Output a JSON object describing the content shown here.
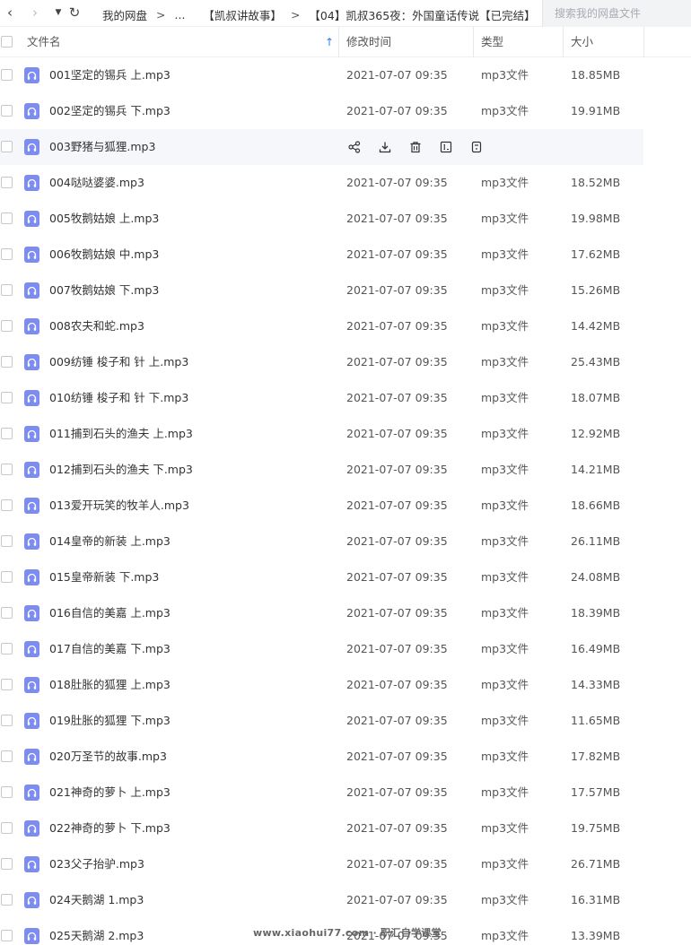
{
  "toolbar": {
    "back_glyph": "‹",
    "forward_glyph": "›",
    "dropdown_glyph": "▼",
    "refresh_glyph": "↻",
    "breadcrumbs": [
      "我的网盘",
      "...",
      "【凯叔讲故事】",
      "【04】凯叔365夜：外国童话传说【已完结】"
    ],
    "separator": ">"
  },
  "search": {
    "placeholder": "搜索我的网盘文件"
  },
  "header": {
    "name": "文件名",
    "time": "修改时间",
    "type": "类型",
    "size": "大小",
    "sort_glyph": "↑"
  },
  "colors": {
    "icon": "#7e8cf2",
    "sort": "#2f7bf5",
    "hover_row": "#f5f7fa"
  },
  "files": [
    {
      "name": "001坚定的锡兵 上.mp3",
      "time": "2021-07-07 09:35",
      "type": "mp3文件",
      "size": "18.85MB"
    },
    {
      "name": "002坚定的锡兵 下.mp3",
      "time": "2021-07-07 09:35",
      "type": "mp3文件",
      "size": "19.91MB"
    },
    {
      "name": "003野猪与狐狸.mp3",
      "time": "",
      "type": "",
      "size": "",
      "hover": true
    },
    {
      "name": "004哒哒婆婆.mp3",
      "time": "2021-07-07 09:35",
      "type": "mp3文件",
      "size": "18.52MB"
    },
    {
      "name": "005牧鹅姑娘 上.mp3",
      "time": "2021-07-07 09:35",
      "type": "mp3文件",
      "size": "19.98MB"
    },
    {
      "name": "006牧鹅姑娘 中.mp3",
      "time": "2021-07-07 09:35",
      "type": "mp3文件",
      "size": "17.62MB"
    },
    {
      "name": "007牧鹅姑娘 下.mp3",
      "time": "2021-07-07 09:35",
      "type": "mp3文件",
      "size": "15.26MB"
    },
    {
      "name": "008农夫和蛇.mp3",
      "time": "2021-07-07 09:35",
      "type": "mp3文件",
      "size": "14.42MB"
    },
    {
      "name": "009纺锤 梭子和 针 上.mp3",
      "time": "2021-07-07 09:35",
      "type": "mp3文件",
      "size": "25.43MB"
    },
    {
      "name": "010纺锤 梭子和 针 下.mp3",
      "time": "2021-07-07 09:35",
      "type": "mp3文件",
      "size": "18.07MB"
    },
    {
      "name": "011捕到石头的渔夫 上.mp3",
      "time": "2021-07-07 09:35",
      "type": "mp3文件",
      "size": "12.92MB"
    },
    {
      "name": "012捕到石头的渔夫 下.mp3",
      "time": "2021-07-07 09:35",
      "type": "mp3文件",
      "size": "14.21MB"
    },
    {
      "name": "013爱开玩笑的牧羊人.mp3",
      "time": "2021-07-07 09:35",
      "type": "mp3文件",
      "size": "18.66MB"
    },
    {
      "name": "014皇帝的新装 上.mp3",
      "time": "2021-07-07 09:35",
      "type": "mp3文件",
      "size": "26.11MB"
    },
    {
      "name": "015皇帝新装 下.mp3",
      "time": "2021-07-07 09:35",
      "type": "mp3文件",
      "size": "24.08MB"
    },
    {
      "name": "016自信的美嘉 上.mp3",
      "time": "2021-07-07 09:35",
      "type": "mp3文件",
      "size": "18.39MB"
    },
    {
      "name": "017自信的美嘉 下.mp3",
      "time": "2021-07-07 09:35",
      "type": "mp3文件",
      "size": "16.49MB"
    },
    {
      "name": "018肚胀的狐狸 上.mp3",
      "time": "2021-07-07 09:35",
      "type": "mp3文件",
      "size": "14.33MB"
    },
    {
      "name": "019肚胀的狐狸 下.mp3",
      "time": "2021-07-07 09:35",
      "type": "mp3文件",
      "size": "11.65MB"
    },
    {
      "name": "020万圣节的故事.mp3",
      "time": "2021-07-07 09:35",
      "type": "mp3文件",
      "size": "17.82MB"
    },
    {
      "name": "021神奇的萝卜 上.mp3",
      "time": "2021-07-07 09:35",
      "type": "mp3文件",
      "size": "17.57MB"
    },
    {
      "name": "022神奇的萝卜 下.mp3",
      "time": "2021-07-07 09:35",
      "type": "mp3文件",
      "size": "19.75MB"
    },
    {
      "name": "023父子抬驴.mp3",
      "time": "2021-07-07 09:35",
      "type": "mp3文件",
      "size": "26.71MB"
    },
    {
      "name": "024天鹅湖  1.mp3",
      "time": "2021-07-07 09:35",
      "type": "mp3文件",
      "size": "16.31MB"
    },
    {
      "name": "025天鹅湖 2.mp3",
      "time": "2021-07-07 09:35",
      "type": "mp3文件",
      "size": "13.39MB"
    }
  ],
  "row_actions": [
    "share-icon",
    "download-icon",
    "delete-icon",
    "rename-icon",
    "more-icon"
  ],
  "watermark": "www.xiaohui77.com · 职汇自学课堂"
}
